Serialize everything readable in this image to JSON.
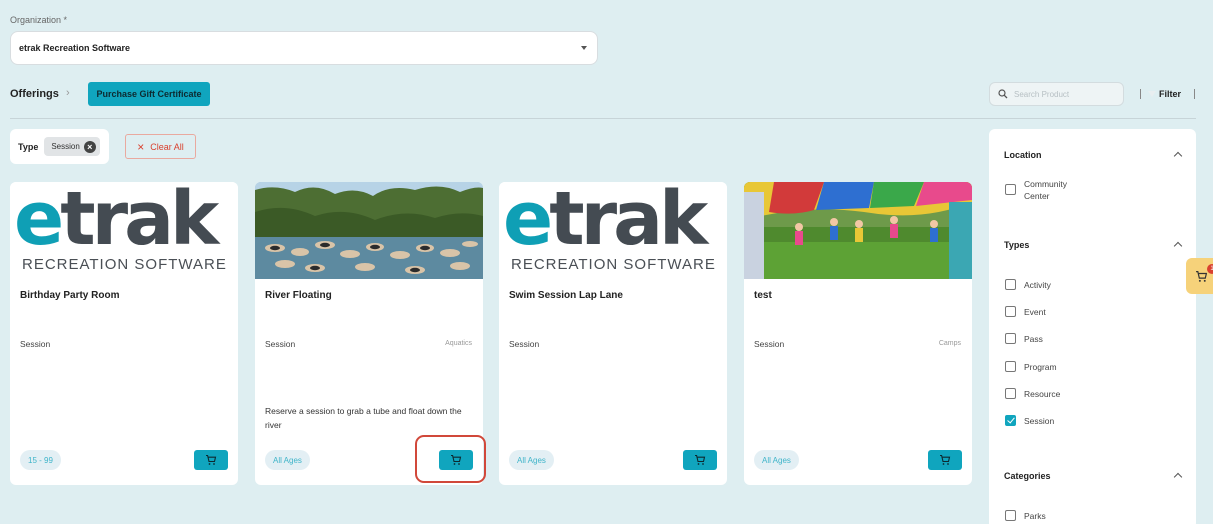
{
  "organization": {
    "label": "Organization *",
    "value": "etrak Recreation Software"
  },
  "header": {
    "breadcrumb": "Offerings",
    "gift_button": "Purchase Gift Certificate",
    "search_placeholder": "Search Product",
    "filter_label": "Filter"
  },
  "filters": {
    "type_label": "Type",
    "type_value": "Session",
    "clear_all": "Clear All"
  },
  "cards": [
    {
      "image": "etrak-logo",
      "logo_text": "trak",
      "logo_sub": "RECREATION SOFTWARE",
      "title": "Birthday Party Room",
      "type": "Session",
      "category": "",
      "description": "",
      "age": "15 - 99"
    },
    {
      "image": "river-photo",
      "title": "River Floating",
      "type": "Session",
      "category": "Aquatics",
      "description": "Reserve a session to grab a tube and float down the river",
      "age": "All Ages"
    },
    {
      "image": "etrak-logo",
      "logo_text": "trak",
      "logo_sub": "RECREATION SOFTWARE",
      "title": "Swim Session Lap Lane",
      "type": "Session",
      "category": "",
      "description": "",
      "age": "All Ages"
    },
    {
      "image": "kids-parachute-photo",
      "title": "test",
      "type": "Session",
      "category": "Camps",
      "description": "",
      "age": "All Ages"
    }
  ],
  "sidebar": {
    "location": {
      "heading": "Location",
      "items": [
        {
          "label": "Community Center",
          "checked": false
        }
      ]
    },
    "types": {
      "heading": "Types",
      "items": [
        {
          "label": "Activity",
          "checked": false
        },
        {
          "label": "Event",
          "checked": false
        },
        {
          "label": "Pass",
          "checked": false
        },
        {
          "label": "Program",
          "checked": false
        },
        {
          "label": "Resource",
          "checked": false
        },
        {
          "label": "Session",
          "checked": true
        }
      ]
    },
    "categories": {
      "heading": "Categories",
      "items": [
        {
          "label": "Parks",
          "checked": false
        }
      ]
    }
  },
  "floating_cart": {
    "badge": "1"
  },
  "colors": {
    "accent": "#10a5be",
    "highlight": "#d1483a",
    "background": "#deeef1"
  }
}
